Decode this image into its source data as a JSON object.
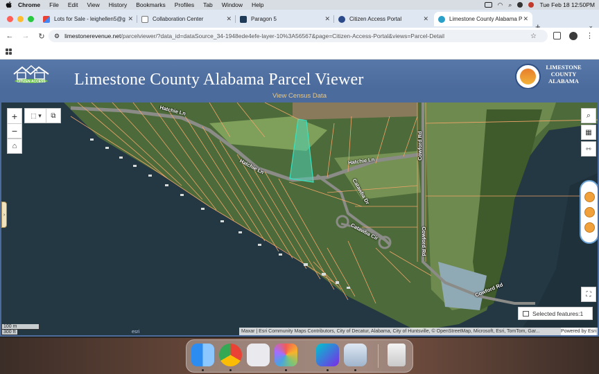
{
  "menubar": {
    "app": "Chrome",
    "items": [
      "File",
      "Edit",
      "View",
      "History",
      "Bookmarks",
      "Profiles",
      "Tab",
      "Window",
      "Help"
    ],
    "clock": "Tue Feb 18  12:50PM"
  },
  "tabs": [
    {
      "title": "Lots for Sale - leighellen5@g",
      "icon": "gmail-icon"
    },
    {
      "title": "Collaboration Center",
      "icon": "page-icon"
    },
    {
      "title": "Paragon 5",
      "icon": "paragon-icon"
    },
    {
      "title": "Citizen Access Portal",
      "icon": "portal-icon"
    },
    {
      "title": "Limestone County Alabama P",
      "icon": "parcel-viewer-icon",
      "active": true
    }
  ],
  "address": {
    "host": "limestonerevenue.net",
    "path": "/parcelviewer/?data_id=dataSource_34-1948ede4efe-layer-10%3A56567&page=Citizen-Access-Portal&views=Parcel-Detail"
  },
  "site": {
    "title": "Limestone County Alabama Parcel Viewer",
    "logo_text": "CITIZEN ACCESS",
    "county_name": [
      "LIMESTONE",
      "COUNTY",
      "ALABAMA"
    ],
    "census_link": "View Census Data"
  },
  "map": {
    "road_labels": {
      "hatchie_1": "Hatchie Ln",
      "hatchie_2": "Hatchie Ln",
      "hatchie_3": "Hatchie Ln",
      "catawba_dr": "Catawba Dr",
      "catawba_cir": "Catawba Cir",
      "cowford_1": "Cowford Rd",
      "cowford_2": "Cowford Rd",
      "cowford_3": "Cowford Rd"
    },
    "selected_features": "Selected features:1",
    "scale": [
      "100 m",
      "300 ft"
    ],
    "esri": "esri",
    "attribution": "Maxar | Esri Community Maps Contributors, City of Decatur, Alabama, City of Huntsville, © OpenStreetMap, Microsoft, Esri, TomTom, Gar...",
    "powered_by": "Powered by Esri"
  },
  "dock": [
    "finder",
    "chrome",
    "launchpad",
    "photos",
    "canva",
    "preview",
    "trash"
  ]
}
